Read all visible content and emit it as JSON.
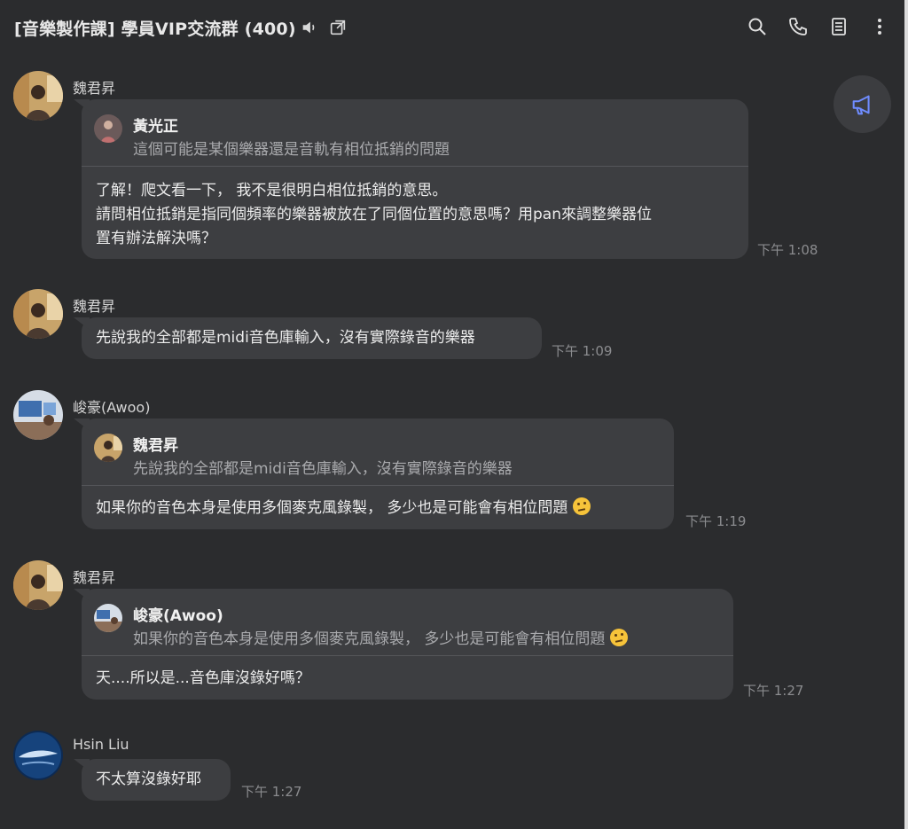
{
  "header": {
    "title": "[音樂製作課] 學員VIP交流群 (400)",
    "icons": [
      "speaker-icon",
      "external-link-icon",
      "search-icon",
      "phone-icon",
      "notes-icon",
      "more-vert-icon"
    ]
  },
  "fab": {
    "icon": "megaphone-icon"
  },
  "messages": [
    {
      "sender": "魏君昇",
      "reply": {
        "name": "黃光正",
        "text": "這個可能是某個樂器還是音軌有相位抵銷的問題"
      },
      "text": "了解！爬文看一下， 我不是很明白相位抵銷的意思。\n請問相位抵銷是指同個頻率的樂器被放在了同個位置的意思嗎？用pan來調整樂器位\n置有辦法解決嗎？",
      "time": "下午 1:08"
    },
    {
      "sender": "魏君昇",
      "text": "先說我的全部都是midi音色庫輸入，沒有實際錄音的樂器",
      "time": "下午 1:09"
    },
    {
      "sender": "峻豪(Awoo)",
      "reply": {
        "name": "魏君昇",
        "text": "先說我的全部都是midi音色庫輸入，沒有實際錄音的樂器"
      },
      "text": "如果你的音色本身是使用多個麥克風錄製， 多少也是可能會有相位問題",
      "emoji": "thinking-face-emoji",
      "time": "下午 1:19"
    },
    {
      "sender": "魏君昇",
      "reply": {
        "name": "峻豪(Awoo)",
        "text": "如果你的音色本身是使用多個麥克風錄製， 多少也是可能會有相位問題",
        "emoji": "thinking-face-emoji"
      },
      "text": "天....所以是...音色庫沒錄好嗎？",
      "time": "下午 1:27"
    },
    {
      "sender": "Hsin Liu",
      "text": "不太算沒錄好耶",
      "time": "下午 1:27"
    }
  ],
  "colors": {
    "background": "#2b2c2e",
    "bubble": "#3d3e41",
    "accent_icon": "#6f8cff",
    "timestamp": "#8b8c8f"
  }
}
